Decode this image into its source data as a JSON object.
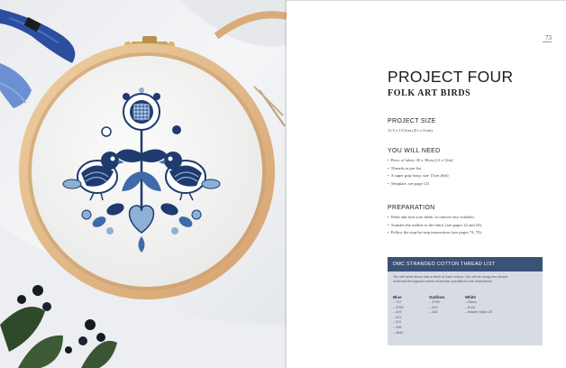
{
  "page_number": "73",
  "title": "PROJECT FOUR",
  "subtitle": "FOLK ART BIRDS",
  "project_size": {
    "heading": "PROJECT SIZE",
    "text": "11.5 x 13.5cm (4½ x 5¼in)"
  },
  "you_will_need": {
    "heading": "YOU WILL NEED",
    "items": [
      "Piece of fabric 30 x 30cm (12 x 12in)",
      "Threads as per list",
      "A super grip hoop, size 15cm (6in)",
      "Template, see page 121"
    ]
  },
  "preparation": {
    "heading": "PREPARATION",
    "items": [
      "Wash and iron your fabric to remove any wrinkles.",
      "Transfer the outline to the fabric (see pages 22 and 23).",
      "Follow the step-by-step instructions (see pages 74–79)."
    ]
  },
  "thread_list": {
    "header": "DMC STRANDED COTTON THREAD LIST",
    "note_line1": "You will need about half a skein of each colour. You will be using one strand",
    "note_line2": "of thread throughout unless otherwise specified in the instructions.",
    "columns": [
      {
        "title": "Blue",
        "items": [
          "747",
          "3766",
          "519",
          "517",
          "311",
          "336",
          "3842"
        ]
      },
      {
        "title": "Outlines",
        "items": [
          "3799",
          "310",
          "414"
        ]
      },
      {
        "title": "White",
        "items": [
          "Blanc",
          "Ecru",
          "Broder blanc 25"
        ]
      }
    ]
  },
  "colors": {
    "thread_header": "#3b5277",
    "thread_box": "#d7dbe3",
    "embroidery_navy": "#1f3a6e",
    "embroidery_mid": "#3f6aa8",
    "embroidery_light": "#8fb0d6",
    "hoop_wood": "#e2b98a"
  }
}
